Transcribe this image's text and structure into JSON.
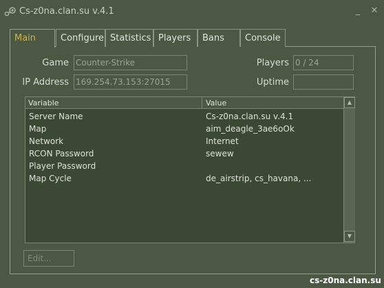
{
  "window": {
    "title": "Cs-z0na.clan.su v.4.1",
    "minimize_label": "_",
    "close_label": "✕"
  },
  "tabs": [
    {
      "label": "Main",
      "active": true
    },
    {
      "label": "Configure"
    },
    {
      "label": "Statistics"
    },
    {
      "label": "Players"
    },
    {
      "label": "Bans"
    },
    {
      "label": "Console"
    }
  ],
  "info": {
    "game_label": "Game",
    "game_value": "Counter-Strike",
    "ip_label": "IP Address",
    "ip_value": "169.254.73.153:27015",
    "players_label": "Players",
    "players_value": "0 / 24",
    "uptime_label": "Uptime",
    "uptime_value": ""
  },
  "list": {
    "columns": [
      "Variable",
      "Value"
    ],
    "rows": [
      {
        "variable": "Server Name",
        "value": "Cs-z0na.clan.su v.4.1"
      },
      {
        "variable": "Map",
        "value": "aim_deagle_3ae6oOk"
      },
      {
        "variable": "Network",
        "value": "Internet"
      },
      {
        "variable": "RCON Password",
        "value": "sewew"
      },
      {
        "variable": "Player Password",
        "value": ""
      },
      {
        "variable": "Map Cycle",
        "value": "de_airstrip, cs_havana, ..."
      }
    ]
  },
  "buttons": {
    "edit_label": "Edit..."
  },
  "watermark": "cs-z0na.clan.su",
  "colors": {
    "background": "#4c5844",
    "active_tab_text": "#c4b550",
    "list_background": "#3d4736"
  }
}
